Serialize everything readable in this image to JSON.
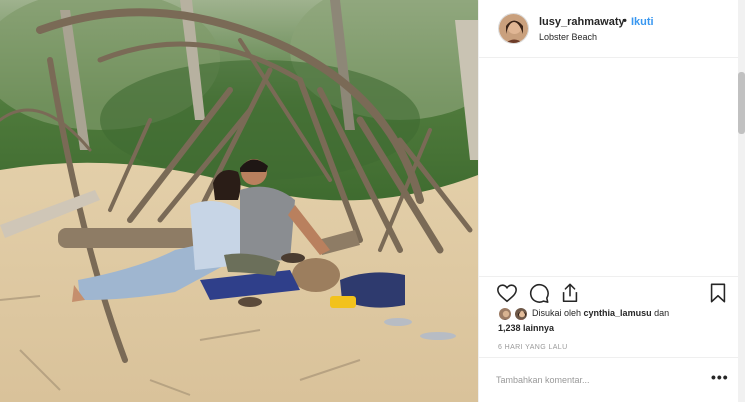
{
  "post": {
    "username": "lusy_rahmawaty",
    "separator": "•",
    "follow_label": "Ikuti",
    "location": "Lobster Beach",
    "icons": {
      "like": "heart-icon",
      "comment": "comment-icon",
      "share": "share-icon",
      "save": "bookmark-icon",
      "more": "more-options-icon"
    },
    "likes": {
      "prefix": "Disukai oleh",
      "liker": "cynthia_lamusu",
      "conjunction": "dan",
      "others": "1,238 lainnya"
    },
    "timestamp": "6 HARI YANG LALU",
    "comment_placeholder": "Tambahkan komentar...",
    "more_label": "•••"
  },
  "colors": {
    "follow": "#3897f0",
    "text": "#262626",
    "muted": "#999999",
    "border": "#efefef"
  }
}
